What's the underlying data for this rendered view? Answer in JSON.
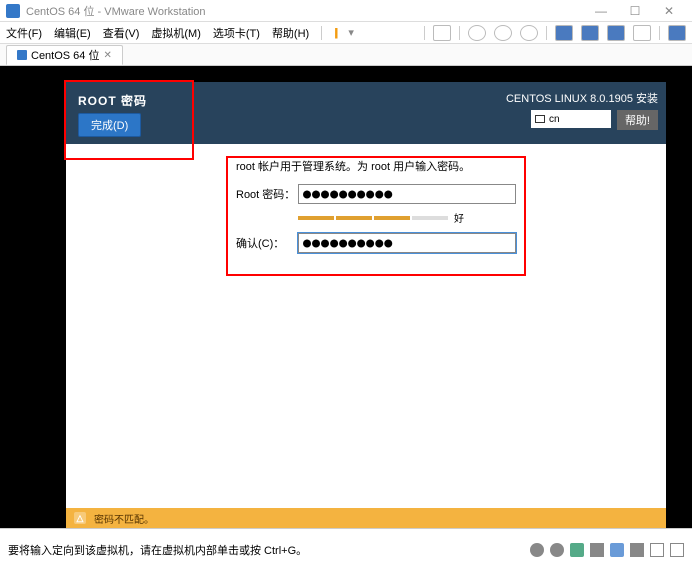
{
  "window": {
    "title": "CentOS 64 位 - VMware Workstation",
    "min": "—",
    "max": "☐",
    "close": "✕"
  },
  "menu": {
    "file": "文件(F)",
    "edit": "编辑(E)",
    "view": "查看(V)",
    "vm": "虚拟机(M)",
    "tabs": "选项卡(T)",
    "help": "帮助(H)",
    "pause": "||",
    "dropdown": "▾"
  },
  "tab": {
    "label": "CentOS 64 位",
    "close": "✕"
  },
  "installer": {
    "title": "ROOT 密码",
    "done": "完成(D)",
    "version": "CENTOS LINUX 8.0.1905 安装",
    "lang": "cn",
    "help": "帮助!",
    "note": "root 帐户用于管理系统。为 root 用户输入密码。",
    "pw_label": "Root 密码：",
    "pw_value": "●●●●●●●●●●",
    "confirm_label": "确认(C)：",
    "confirm_value": "●●●●●●●●●●",
    "strength_label": "好",
    "warning": "密码不匹配。"
  },
  "statusbar": {
    "hint": "要将输入定向到该虚拟机，请在虚拟机内部单击或按 Ctrl+G。"
  }
}
